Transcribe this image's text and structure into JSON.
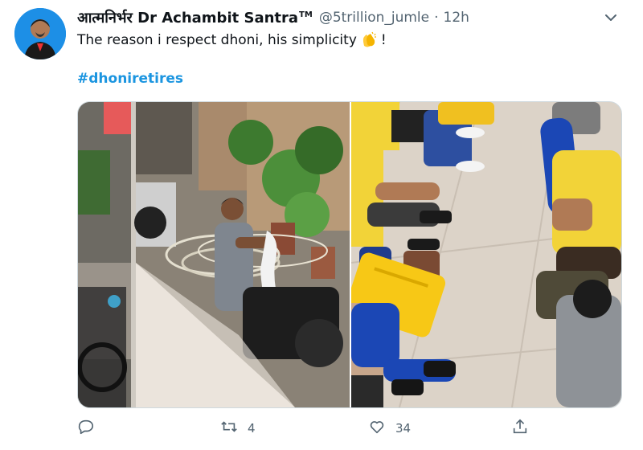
{
  "tweet": {
    "display_name": "आत्मनिर्भर Dr Achambit Santra",
    "tm": "TM",
    "handle": "@5trillion_jumle",
    "separator": "·",
    "time": "12h",
    "text_before": "The reason i respect dhoni, his simplicity",
    "text_after": "!",
    "emoji_icon": "clapping-hands-icon",
    "hashtag": "#dhoniretires"
  },
  "media": {
    "left_photo": "photo-man-washing-cloth",
    "right_photo": "photo-players-sitting-on-floor"
  },
  "actions": {
    "reply_icon": "reply-icon",
    "retweet_icon": "retweet-icon",
    "retweet_count": "4",
    "like_icon": "heart-icon",
    "like_count": "34",
    "share_icon": "share-icon"
  },
  "colors": {
    "accent": "#1b95e0",
    "muted": "#536471",
    "jersey_yellow": "#f2d338",
    "jersey_blue": "#1f3c8c"
  }
}
